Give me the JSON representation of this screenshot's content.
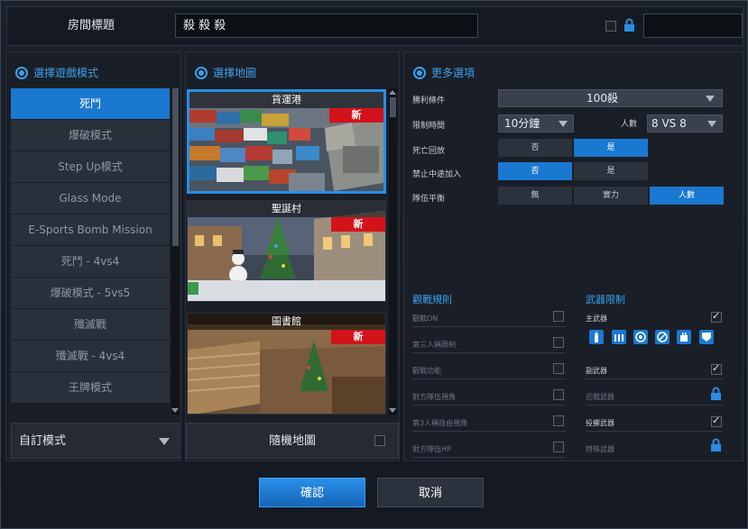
{
  "header": {
    "room_title_label": "房間標題",
    "room_title_value": "殺 殺 殺"
  },
  "mode_panel": {
    "title": "選擇遊戲模式",
    "items": [
      "死鬥",
      "爆破模式",
      "Step Up模式",
      "Glass Mode",
      "E-Sports Bomb Mission",
      "死鬥 - 4vs4",
      "爆破模式 - 5vs5",
      "殲滅戰",
      "殲滅戰 - 4vs4",
      "王牌模式"
    ],
    "active_index": 0,
    "custom_mode": "自訂模式"
  },
  "map_panel": {
    "title": "選擇地圖",
    "maps": [
      {
        "name": "貨運港",
        "badge": "新"
      },
      {
        "name": "聖誕村",
        "badge": "新"
      },
      {
        "name": "圖書館",
        "badge": "新"
      }
    ],
    "random_map": "隨機地圖"
  },
  "options_panel": {
    "title": "更多選項",
    "win_condition_label": "勝利條件",
    "win_condition_value": "100殺",
    "time_limit_label": "限制時間",
    "time_limit_value": "10分鐘",
    "players_label": "人數",
    "players_value": "8 VS 8",
    "respawn_label": "死亡回放",
    "respawn_options": [
      "否",
      "是"
    ],
    "respawn_selected": 1,
    "join_label": "禁止中途加入",
    "join_options": [
      "否",
      "是"
    ],
    "join_selected": 0,
    "balance_label": "隊伍平衡",
    "balance_options": [
      "無",
      "實力",
      "人數"
    ],
    "balance_selected": 2
  },
  "spectate": {
    "title": "觀戰規則",
    "rules": [
      "觀戰ON",
      "第三人稱限制",
      "觀戰功能",
      "對方隊伍視角",
      "第3人稱自由視角",
      "對方隊伍HP"
    ]
  },
  "weapons": {
    "title": "武器限制",
    "primary": "主武器",
    "secondary": "副武器",
    "melee": "近戰武器",
    "throwing": "投擲武器",
    "special": "特殊武器"
  },
  "buttons": {
    "confirm": "確認",
    "cancel": "取消"
  },
  "colors": {
    "accent": "#1b78d0",
    "badge": "#d4121a",
    "title_blue": "#3aa0ee"
  }
}
